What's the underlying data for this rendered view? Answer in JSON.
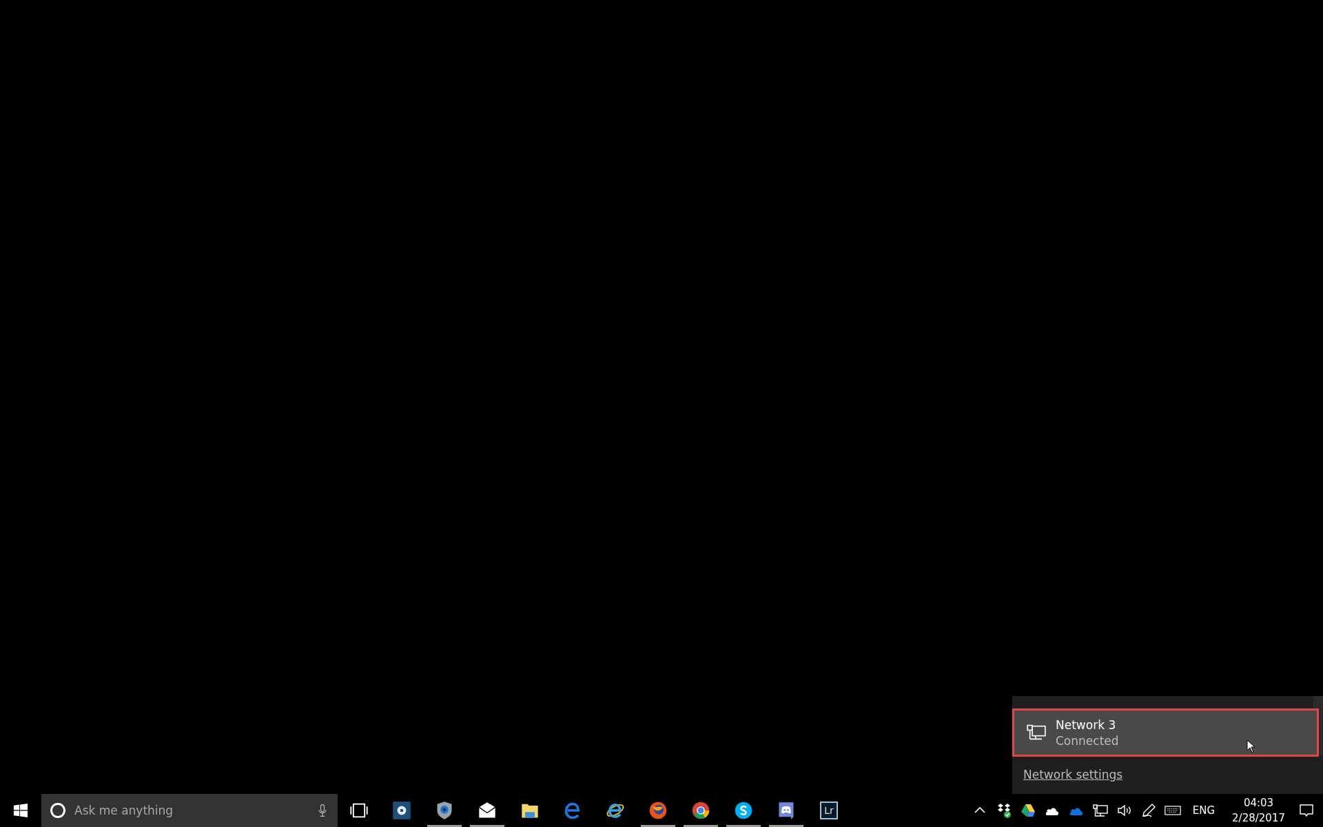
{
  "network_flyout": {
    "networks": [
      {
        "name": "Network 3",
        "status": "Connected",
        "selected": true
      }
    ],
    "settings_link": "Network settings"
  },
  "taskbar": {
    "search": {
      "placeholder": "Ask me anything"
    },
    "apps": [
      {
        "running": false
      },
      {
        "running": true
      },
      {
        "running": true
      },
      {
        "running": false
      },
      {
        "running": false
      },
      {
        "running": false
      },
      {
        "running": true
      },
      {
        "running": true
      },
      {
        "running": true
      },
      {
        "running": true
      },
      {
        "running": false,
        "label": "Lr"
      }
    ],
    "tray": {
      "language": "ENG",
      "time": "04:03",
      "date": "2/28/2017"
    }
  }
}
